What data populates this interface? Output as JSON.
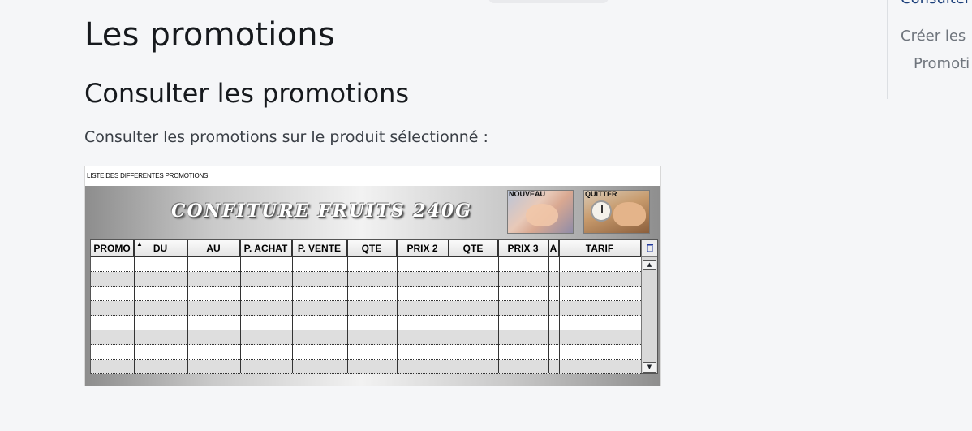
{
  "page": {
    "title": "Les promotions",
    "section_title": "Consulter les promotions",
    "paragraph": "Consulter les promotions sur le produit sélectionné :"
  },
  "toc": {
    "active": "Consulter",
    "items": [
      "Créer les",
      "Promoti"
    ]
  },
  "window": {
    "title": "LISTE DES DIFFERENTES PROMOTIONS",
    "product_name": "CONFITURE FRUITS 240G",
    "buttons": {
      "nouveau": "NOUVEAU",
      "quitter": "QUITTER"
    },
    "columns": [
      "PROMO",
      "DU",
      "AU",
      "P. ACHAT",
      "P. VENTE",
      "QTE",
      "PRIX 2",
      "QTE",
      "PRIX 3",
      "A",
      "TARIF"
    ],
    "sort_indicator": "▲",
    "scroll_up": "▲",
    "scroll_down": "▼",
    "corner_icon": "trash-icon"
  }
}
